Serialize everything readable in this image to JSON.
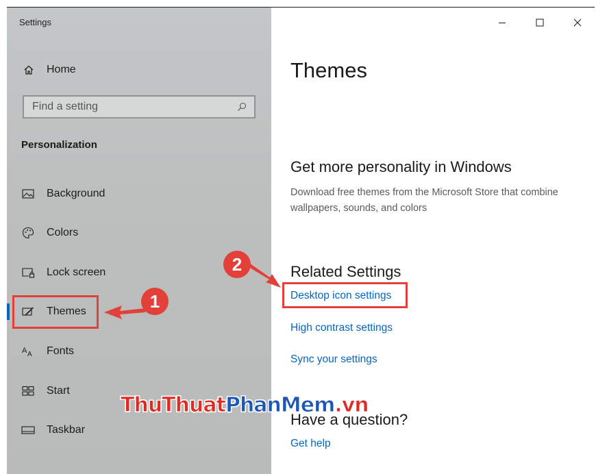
{
  "window": {
    "title": "Settings",
    "controls": {
      "minimize": "—",
      "maximize": "☐",
      "close": "✕"
    }
  },
  "sidebar": {
    "home_label": "Home",
    "search_placeholder": "Find a setting",
    "section_title": "Personalization",
    "items": [
      {
        "label": "Background",
        "icon": "image-icon"
      },
      {
        "label": "Colors",
        "icon": "palette-icon"
      },
      {
        "label": "Lock screen",
        "icon": "lock-screen-icon"
      },
      {
        "label": "Themes",
        "icon": "themes-icon",
        "active": true
      },
      {
        "label": "Fonts",
        "icon": "fonts-icon"
      },
      {
        "label": "Start",
        "icon": "start-icon"
      },
      {
        "label": "Taskbar",
        "icon": "taskbar-icon"
      }
    ]
  },
  "main": {
    "page_title": "Themes",
    "personality_heading": "Get more personality in Windows",
    "personality_desc": "Download free themes from the Microsoft Store that combine wallpapers, sounds, and colors",
    "related_heading": "Related Settings",
    "related_links": [
      "Desktop icon settings",
      "High contrast settings",
      "Sync your settings"
    ],
    "question_heading": "Have a question?",
    "help_link": "Get help"
  },
  "annotations": {
    "badge_1": "1",
    "badge_2": "2",
    "color": "#e3403a"
  },
  "watermark": {
    "part1": "ThuThuat",
    "part2": "PhanMem",
    "part3": ".vn"
  },
  "colors": {
    "accent": "#0067c0",
    "sidebar_bg": "#bdbfbf"
  }
}
